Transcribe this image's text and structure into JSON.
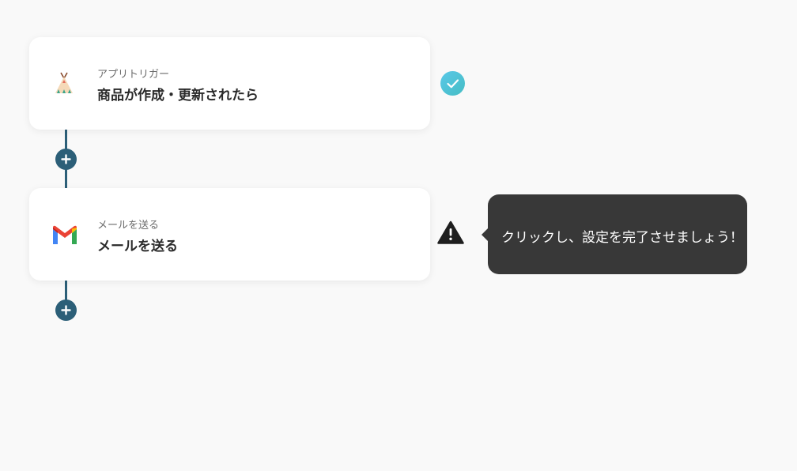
{
  "flow": {
    "steps": [
      {
        "subtitle": "アプリトリガー",
        "title": "商品が作成・更新されたら",
        "app_icon": "teepee-icon",
        "status": "complete",
        "status_icon": "check-circle-icon"
      },
      {
        "subtitle": "メールを送る",
        "title": "メールを送る",
        "app_icon": "gmail-icon",
        "status": "incomplete",
        "status_icon": "warning-icon"
      }
    ],
    "add_step_icon": "plus-icon"
  },
  "tooltip": {
    "text": "クリックし、設定を完了させましょう！"
  },
  "colors": {
    "background": "#f9f9f9",
    "connector": "#2c5f78",
    "check": "#4fc3d6",
    "tooltip_bg": "#383838"
  }
}
